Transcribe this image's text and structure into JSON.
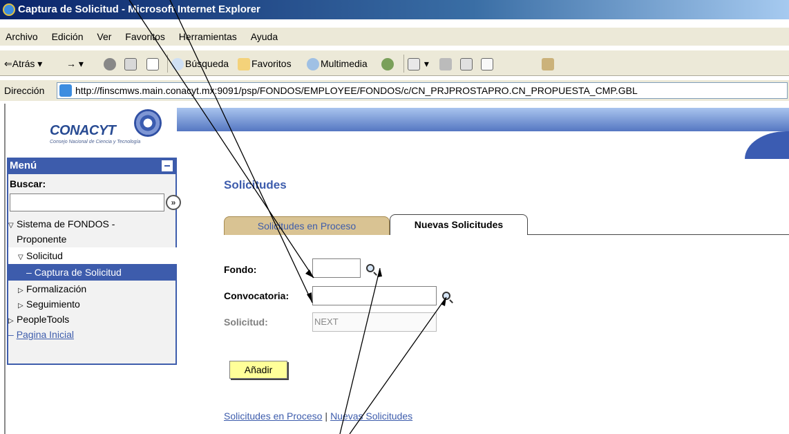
{
  "window": {
    "title": "Captura de Solicitud - Microsoft Internet Explorer"
  },
  "menubar": {
    "items": [
      "Archivo",
      "Edición",
      "Ver",
      "Favoritos",
      "Herramientas",
      "Ayuda"
    ]
  },
  "toolbar": {
    "back": "Atrás",
    "search": "Búsqueda",
    "favorites": "Favoritos",
    "multimedia": "Multimedia"
  },
  "address": {
    "label": "Dirección",
    "url": "http://finscmws.main.conacyt.mx:9091/psp/FONDOS/EMPLOYEE/FONDOS/c/CN_PRJPROSTAPRO.CN_PROPUESTA_CMP.GBL"
  },
  "logo": {
    "name": "CONACYT",
    "subtitle": "Consejo Nacional de Ciencia y Tecnología"
  },
  "sidebar": {
    "title": "Menú",
    "search_label": "Buscar:",
    "items": [
      {
        "label": "Sistema de FONDOS -",
        "indent": 0,
        "marker": "▽"
      },
      {
        "label": "Proponente",
        "indent": 0,
        "marker": ""
      },
      {
        "label": "Solicitud",
        "indent": 1,
        "marker": "▽"
      },
      {
        "label": "Captura de Solicitud",
        "indent": 2,
        "marker": "–"
      },
      {
        "label": "Formalización",
        "indent": 1,
        "marker": "▷"
      },
      {
        "label": "Seguimiento",
        "indent": 1,
        "marker": "▷"
      },
      {
        "label": "PeopleTools",
        "indent": 0,
        "marker": "▷"
      },
      {
        "label": "Pagina Inicial",
        "indent": 0,
        "marker": "–"
      }
    ]
  },
  "main": {
    "title": "Solicitudes",
    "tabs": [
      {
        "label": "Solicitudes en Proceso",
        "active": false
      },
      {
        "label": "Nuevas Solicitudes",
        "active": true
      }
    ],
    "fields": {
      "fondo_label": "Fondo:",
      "fondo_value": "",
      "convocatoria_label": "Convocatoria:",
      "convocatoria_value": "",
      "solicitud_label": "Solicitud:",
      "solicitud_value": "NEXT"
    },
    "add_button": "Añadir",
    "links": [
      "Solicitudes en Proceso",
      "Nuevas Solicitudes"
    ]
  }
}
